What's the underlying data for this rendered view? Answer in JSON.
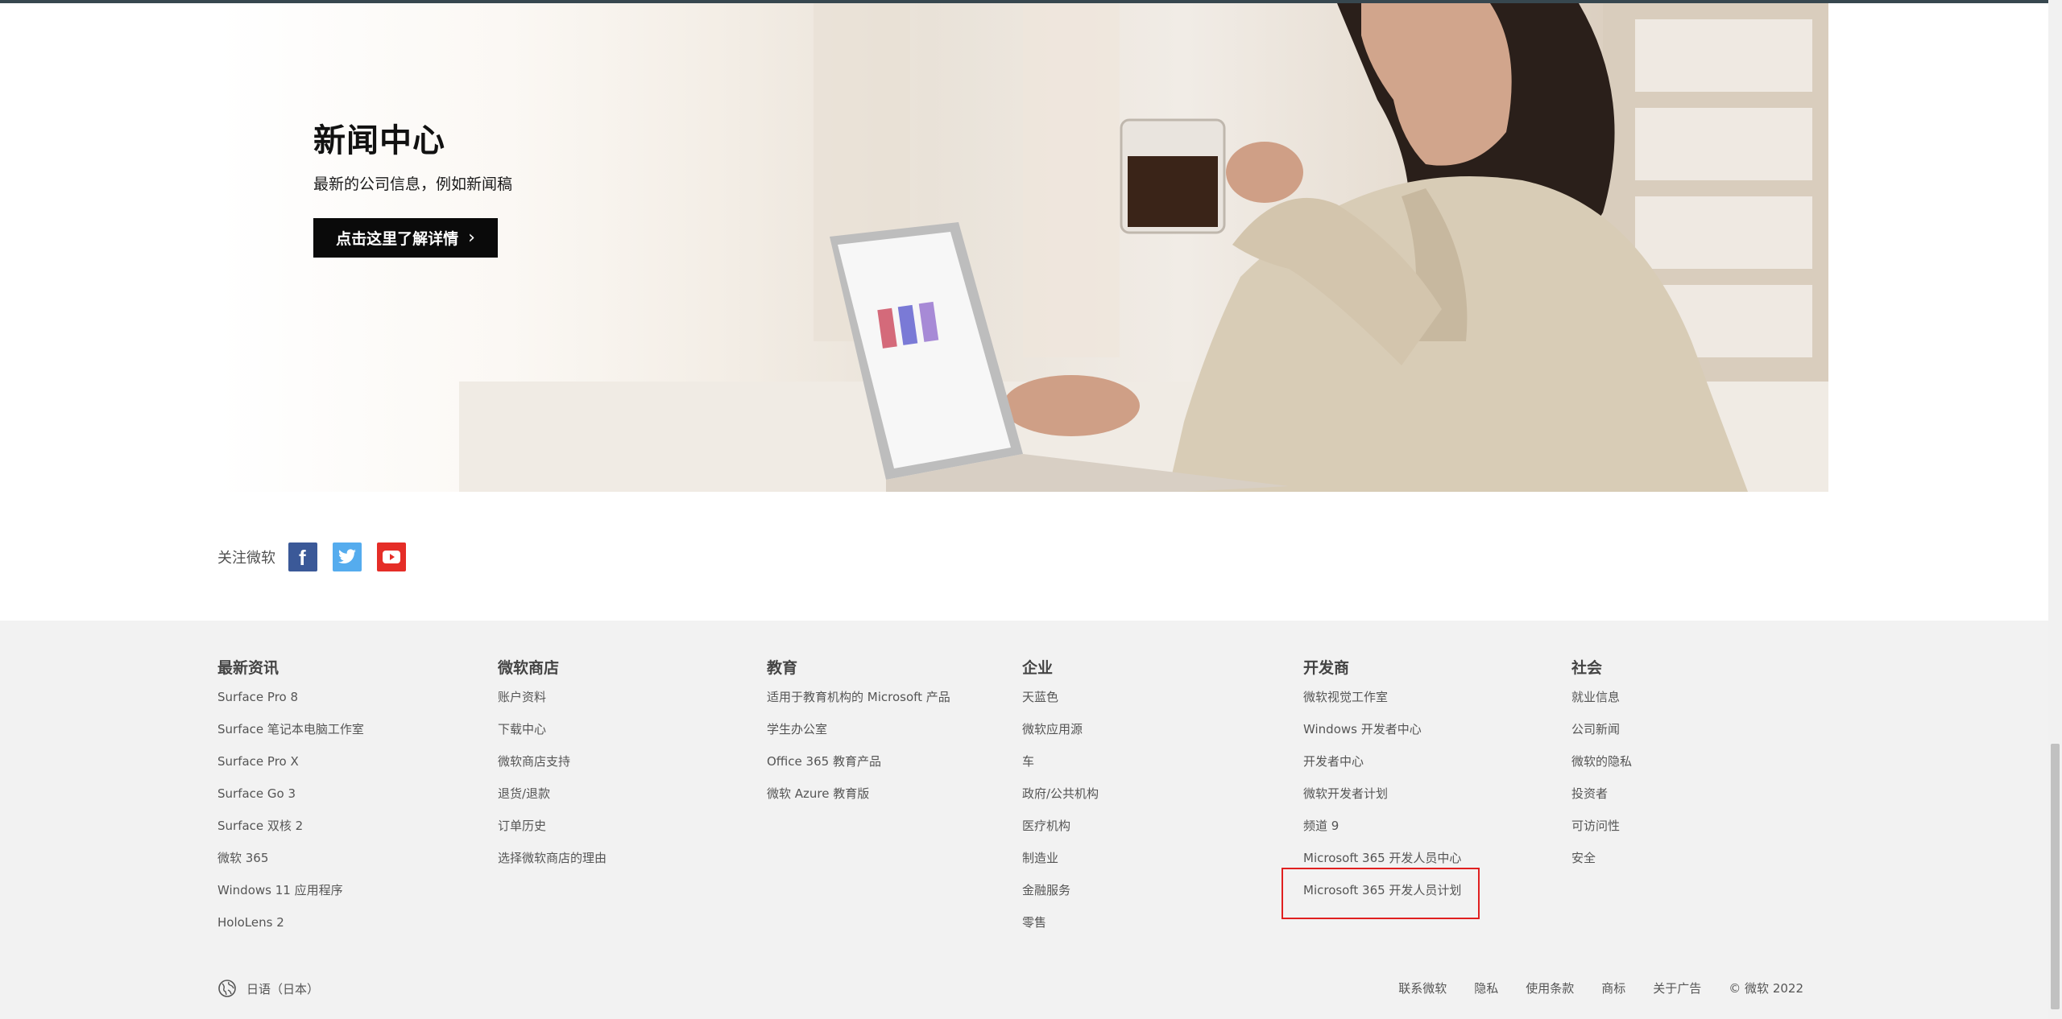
{
  "hero": {
    "title": "新闻中心",
    "subtitle": "最新的公司信息，例如新闻稿",
    "button_label": "点击这里了解详情",
    "button_chevron": "›"
  },
  "follow": {
    "label": "关注微软",
    "icons": [
      "facebook-icon",
      "twitter-icon",
      "youtube-icon"
    ]
  },
  "footer": {
    "columns": [
      {
        "heading": "最新资讯",
        "links": [
          "Surface Pro 8",
          "Surface 笔记本电脑工作室",
          "Surface Pro X",
          "Surface Go 3",
          "Surface 双核 2",
          "微软 365",
          "Windows 11 应用程序",
          "HoloLens 2"
        ]
      },
      {
        "heading": "微软商店",
        "links": [
          "账户资料",
          "下载中心",
          "微软商店支持",
          "退货/退款",
          "订单历史",
          "选择微软商店的理由"
        ]
      },
      {
        "heading": "教育",
        "links": [
          "适用于教育机构的 Microsoft 产品",
          "学生办公室",
          "Office 365 教育产品",
          "微软 Azure 教育版"
        ]
      },
      {
        "heading": "企业",
        "links": [
          "天蓝色",
          "微软应用源",
          "车",
          "政府/公共机构",
          "医疗机构",
          "制造业",
          "金融服务",
          "零售"
        ]
      },
      {
        "heading": "开发商",
        "links": [
          "微软视觉工作室",
          "Windows 开发者中心",
          "开发者中心",
          "微软开发者计划",
          "频道 9",
          "Microsoft 365 开发人员中心",
          "Microsoft 365 开发人员计划"
        ]
      },
      {
        "heading": "社会",
        "links": [
          "就业信息",
          "公司新闻",
          "微软的隐私",
          "投资者",
          "可访问性",
          "安全"
        ]
      }
    ],
    "locale": "日语（日本）",
    "bottom_links": [
      "联系微软",
      "隐私",
      "使用条款",
      "商标",
      "关于广告",
      "© 微软 2022"
    ]
  },
  "colors": {
    "footer_bg": "#f2f2f2",
    "button_bg": "#0a0a0a",
    "facebook": "#3b5998",
    "twitter": "#55acee",
    "youtube": "#e52d27",
    "highlight": "#e02020"
  }
}
